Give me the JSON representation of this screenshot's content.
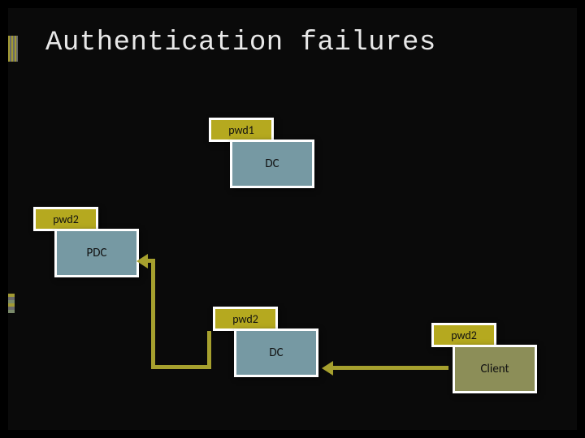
{
  "title": "Authentication failures",
  "nodes": {
    "dc_top_tag": "pwd1",
    "dc_top": "DC",
    "pdc_tag": "pwd2",
    "pdc": "PDC",
    "dc_bottom_tag": "pwd2",
    "dc_bottom": "DC",
    "client_tag": "pwd2",
    "client": "Client"
  },
  "colors": {
    "tag_bg": "#b5a91f",
    "steel_bg": "#7699a3",
    "olive_bg": "#8c8e58",
    "connector": "#a6a02e",
    "accent": "#a29a33",
    "title_color": "#e8e8e8",
    "page_bg": "#000000"
  },
  "chart_data": {
    "type": "diagram",
    "title": "Authentication failures",
    "nodes": [
      {
        "id": "dc_top",
        "label": "DC",
        "tag": "pwd1"
      },
      {
        "id": "pdc",
        "label": "PDC",
        "tag": "pwd2"
      },
      {
        "id": "dc_bottom",
        "label": "DC",
        "tag": "pwd2"
      },
      {
        "id": "client",
        "label": "Client",
        "tag": "pwd2"
      }
    ],
    "edges": [
      {
        "from": "client",
        "to": "dc_bottom"
      },
      {
        "from": "dc_bottom",
        "to": "pdc"
      }
    ]
  }
}
